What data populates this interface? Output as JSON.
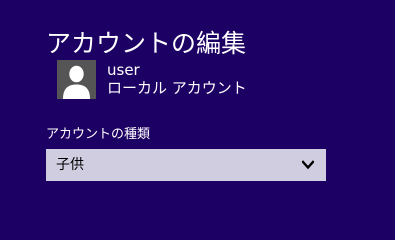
{
  "page": {
    "title": "アカウントの編集"
  },
  "user": {
    "name": "user",
    "account_kind": "ローカル アカウント",
    "avatar_icon": "user-silhouette-icon"
  },
  "account_type": {
    "label": "アカウントの種類",
    "selected": "子供",
    "dropdown_icon": "chevron-down-icon"
  },
  "colors": {
    "background": "#1d0063",
    "select_background": "#d1cde0",
    "avatar_background": "#555555"
  }
}
